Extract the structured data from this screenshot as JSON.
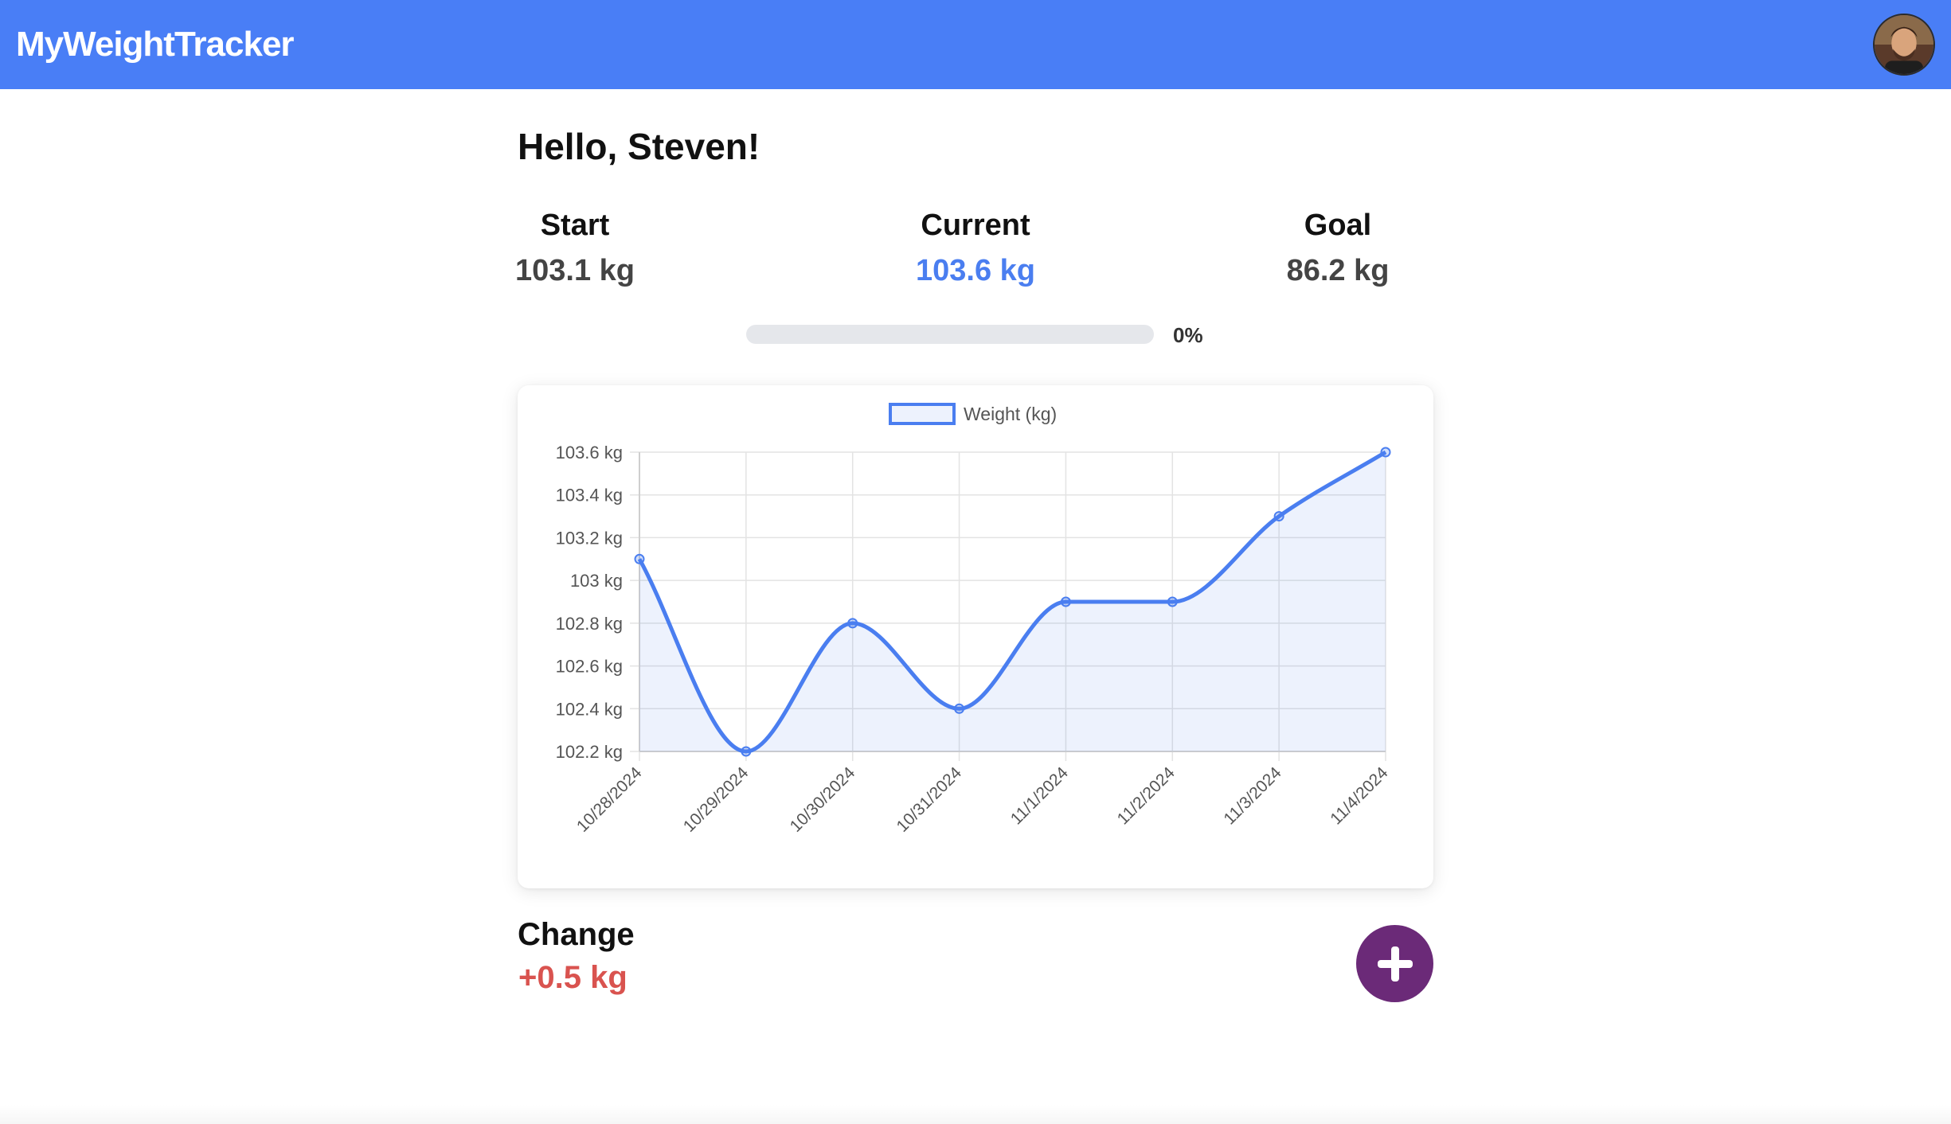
{
  "app": {
    "brand": "MyWeightTracker",
    "avatar_icon": "user-avatar"
  },
  "greeting": "Hello, Steven!",
  "stats": {
    "start": {
      "label": "Start",
      "value": "103.1 kg"
    },
    "current": {
      "label": "Current",
      "value": "103.6 kg"
    },
    "goal": {
      "label": "Goal",
      "value": "86.2 kg"
    }
  },
  "progress": {
    "percent": 0,
    "text": "0%"
  },
  "change": {
    "label": "Change",
    "value": "+0.5 kg"
  },
  "add_button": {
    "icon": "plus-icon",
    "color": "#6b2a78"
  },
  "colors": {
    "accent": "#497ef6",
    "increase": "#d9534f"
  },
  "chart_data": {
    "type": "line",
    "legend_position": "top-center",
    "grid": true,
    "series": [
      {
        "name": "Weight (kg)",
        "color": "#4a7ef0",
        "fill": true,
        "values": [
          103.1,
          102.2,
          102.8,
          102.4,
          102.9,
          102.9,
          103.3,
          103.6
        ]
      }
    ],
    "x": [
      "10/28/2024",
      "10/29/2024",
      "10/30/2024",
      "10/31/2024",
      "11/1/2024",
      "11/2/2024",
      "11/3/2024",
      "11/4/2024"
    ],
    "y_ticks": [
      "102.2 kg",
      "102.4 kg",
      "102.6 kg",
      "102.8 kg",
      "103 kg",
      "103.2 kg",
      "103.4 kg",
      "103.6 kg"
    ],
    "ylim": [
      102.2,
      103.6
    ]
  }
}
